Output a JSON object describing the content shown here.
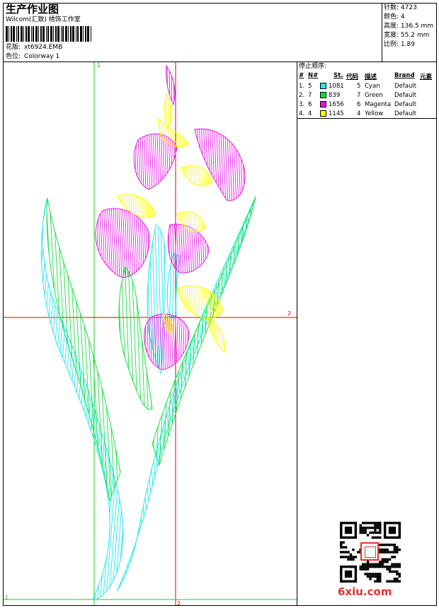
{
  "header": {
    "title": "生产作业图",
    "subtitle": "Wilcom(汇致) 绣饰工作室",
    "design_label": "花版:",
    "design_value": "xt6924.EMB",
    "colorway_label": "色位:",
    "colorway_value": "Colorway 1"
  },
  "stats": [
    {
      "label": "针数:",
      "value": "4723"
    },
    {
      "label": "颜色:",
      "value": "4"
    },
    {
      "label": "高度:",
      "value": "136.5 mm"
    },
    {
      "label": "宽度:",
      "value": "55.2 mm"
    },
    {
      "label": "比例:",
      "value": "1.89"
    }
  ],
  "table": {
    "caption": "停止顺序:",
    "headers": [
      "#",
      "N#",
      "St.",
      "代码",
      "描述",
      "Brand",
      "元素"
    ],
    "rows": [
      {
        "idx": "1.",
        "n": "5",
        "color": "#22e8f0",
        "st": "1081",
        "code": "5",
        "desc": "Cyan",
        "brand": "Default"
      },
      {
        "idx": "2.",
        "n": "7",
        "color": "#00e040",
        "st": "839",
        "code": "7",
        "desc": "Green",
        "brand": "Default"
      },
      {
        "idx": "3.",
        "n": "6",
        "color": "#ff00ff",
        "st": "1656",
        "code": "6",
        "desc": "Magenta",
        "brand": "Default"
      },
      {
        "idx": "4.",
        "n": "4",
        "color": "#ffff00",
        "st": "1145",
        "code": "4",
        "desc": "Yellow",
        "brand": "Default"
      }
    ]
  },
  "guides": {
    "v1": "1",
    "h2": "2",
    "corner": "1",
    "bottom2": "2"
  },
  "watermark": {
    "text": "6xiu.com"
  },
  "colors": {
    "cyan": "#22e8f0",
    "green": "#19e046",
    "magenta": "#e020e0",
    "yellow": "#ffff00",
    "guide_green": "#22cc22",
    "guide_red": "#dd0000"
  }
}
